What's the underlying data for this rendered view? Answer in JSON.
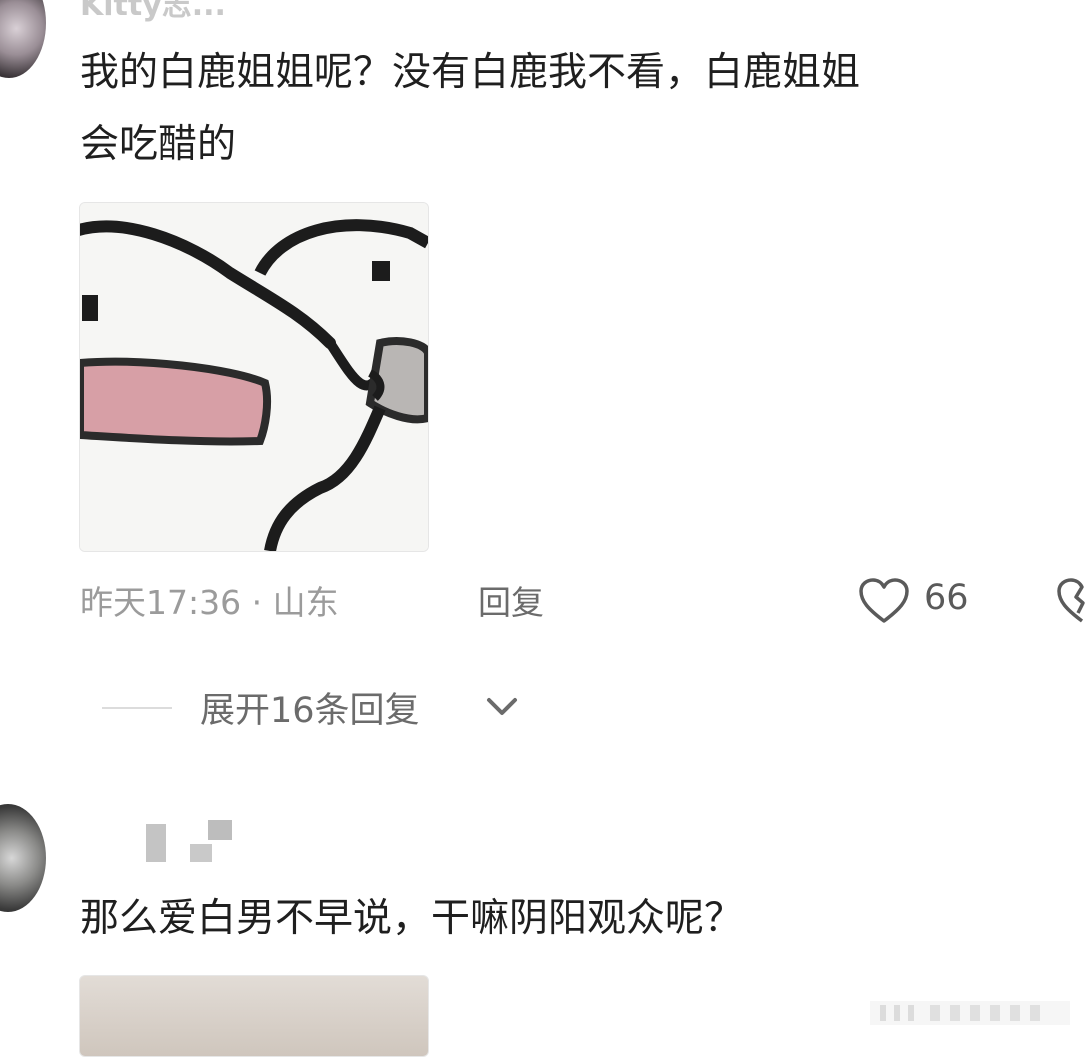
{
  "comment1": {
    "username_partial": "Kitty志...",
    "text_line1": "我的白鹿姐姐呢？没有白鹿我不看，白鹿姐姐",
    "text_line2": "会吃醋的",
    "time": "昨天17:36",
    "separator": "·",
    "location": "山东",
    "reply_label": "回复",
    "like_count": "66",
    "like_icon": "heart-outline-icon",
    "dislike_icon": "broken-heart-icon",
    "expand_replies": "展开16条回复"
  },
  "comment2": {
    "text": "那么爱白男不早说，干嘛阴阳观众呢？"
  },
  "colors": {
    "text_primary": "#1f1f1f",
    "text_secondary": "#9b9b9b",
    "text_action": "#6b6b6b"
  }
}
